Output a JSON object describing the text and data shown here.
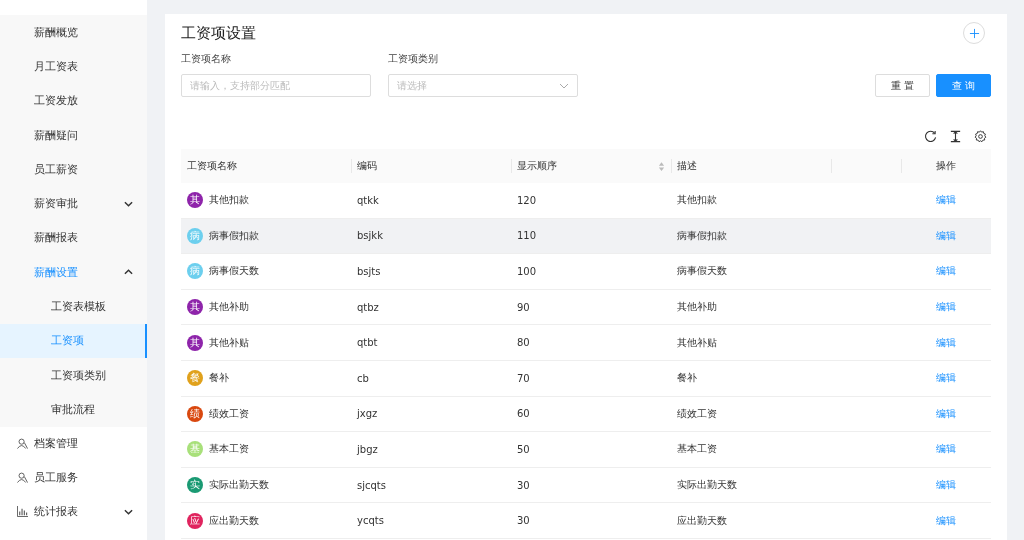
{
  "sidebar": {
    "submenu": [
      {
        "label": "薪酬概览",
        "selected": false
      },
      {
        "label": "月工资表",
        "selected": false
      },
      {
        "label": "工资发放",
        "selected": false
      },
      {
        "label": "薪酬疑问",
        "selected": false
      },
      {
        "label": "员工薪资",
        "selected": false
      },
      {
        "label": "薪资审批",
        "selected": false,
        "expanded": false
      },
      {
        "label": "薪酬报表",
        "selected": false
      },
      {
        "label": "薪酬设置",
        "selected": true,
        "expanded": true,
        "children": [
          {
            "label": "工资表模板",
            "selected": false
          },
          {
            "label": "工资项",
            "selected": true
          },
          {
            "label": "工资项类别",
            "selected": false
          },
          {
            "label": "审批流程",
            "selected": false
          }
        ]
      }
    ],
    "items": [
      {
        "label": "档案管理",
        "selected": false
      },
      {
        "label": "员工服务",
        "selected": false
      },
      {
        "label": "统计报表",
        "selected": false,
        "expanded": false
      }
    ]
  },
  "page": {
    "title": "工资项设置",
    "filters": [
      {
        "kind": "text",
        "label": "工资项名称",
        "placeholder": "请输入，支持部分匹配"
      },
      {
        "kind": "select",
        "label": "工资项类别",
        "placeholder": "请选择"
      }
    ],
    "buttons": [
      {
        "label": "重 置",
        "kind": "default"
      },
      {
        "label": "查 询",
        "kind": "primary"
      }
    ]
  },
  "table": {
    "columns": [
      {
        "label": "工资项名称"
      },
      {
        "label": "编码"
      },
      {
        "label": "显示顺序",
        "sortable": true
      },
      {
        "label": "描述"
      },
      {
        "label": "操作"
      }
    ],
    "rows": [
      {
        "badge": "其",
        "color": "#8e24aa",
        "name": "其他扣款",
        "code": "qtkk",
        "order": "120",
        "description": "其他扣款",
        "action": "编辑",
        "hovered": false
      },
      {
        "badge": "病",
        "color": "#6ccfee",
        "name": "病事假扣款",
        "code": "bsjkk",
        "order": "110",
        "description": "病事假扣款",
        "action": "编辑",
        "hovered": true
      },
      {
        "badge": "病",
        "color": "#6ccfee",
        "name": "病事假天数",
        "code": "bsjts",
        "order": "100",
        "description": "病事假天数",
        "action": "编辑",
        "hovered": false
      },
      {
        "badge": "其",
        "color": "#8e24aa",
        "name": "其他补助",
        "code": "qtbz",
        "order": "90",
        "description": "其他补助",
        "action": "编辑",
        "hovered": false
      },
      {
        "badge": "其",
        "color": "#8e24aa",
        "name": "其他补贴",
        "code": "qtbt",
        "order": "80",
        "description": "其他补贴",
        "action": "编辑",
        "hovered": false
      },
      {
        "badge": "餐",
        "color": "#e0a11c",
        "name": "餐补",
        "code": "cb",
        "order": "70",
        "description": "餐补",
        "action": "编辑",
        "hovered": false
      },
      {
        "badge": "绩",
        "color": "#d9480f",
        "name": "绩效工资",
        "code": "jxgz",
        "order": "60",
        "description": "绩效工资",
        "action": "编辑",
        "hovered": false
      },
      {
        "badge": "基",
        "color": "#a8e07a",
        "name": "基本工资",
        "code": "jbgz",
        "order": "50",
        "description": "基本工资",
        "action": "编辑",
        "hovered": false
      },
      {
        "badge": "实",
        "color": "#1a9a73",
        "name": "实际出勤天数",
        "code": "sjcqts",
        "order": "30",
        "description": "实际出勤天数",
        "action": "编辑",
        "hovered": false
      },
      {
        "badge": "应",
        "color": "#e0245e",
        "name": "应出勤天数",
        "code": "ycqts",
        "order": "30",
        "description": "应出勤天数",
        "action": "编辑",
        "hovered": false
      }
    ]
  }
}
